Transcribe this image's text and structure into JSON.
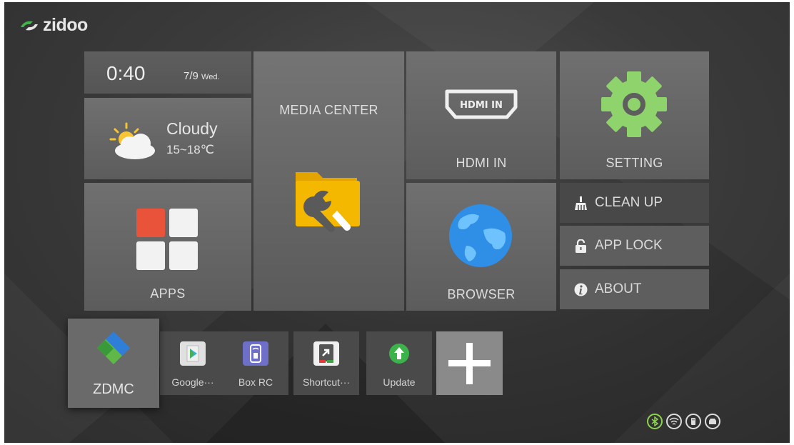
{
  "brand": {
    "logo_text": "zidoo",
    "logo_color": "#3fb54c"
  },
  "clock": {
    "time": "0:40",
    "date": "7/9",
    "weekday": "Wed."
  },
  "weather": {
    "condition": "Cloudy",
    "temp_range": "15~18℃"
  },
  "tiles": {
    "apps": "APPS",
    "media_center": "MEDIA CENTER",
    "hdmi_in": "HDMI IN",
    "hdmi_icon_text": "HDMI IN",
    "setting": "SETTING",
    "browser": "BROWSER"
  },
  "side_menu": {
    "clean_up": "CLEAN UP",
    "app_lock": "APP LOCK",
    "about": "ABOUT"
  },
  "dock": {
    "zdmc": "ZDMC",
    "google_play": "Google···",
    "box_rc": "Box RC",
    "shortcut": "Shortcut···",
    "update": "Update"
  },
  "status_icons": [
    "bluetooth-icon",
    "wifi-icon",
    "usb-icon",
    "storage-icon"
  ],
  "colors": {
    "accent_green": "#8ed36b",
    "folder_yellow": "#f5b800",
    "globe_blue": "#2f8ee6",
    "apps_red": "#e8533a",
    "bluetooth_active": "#8bd34d"
  }
}
